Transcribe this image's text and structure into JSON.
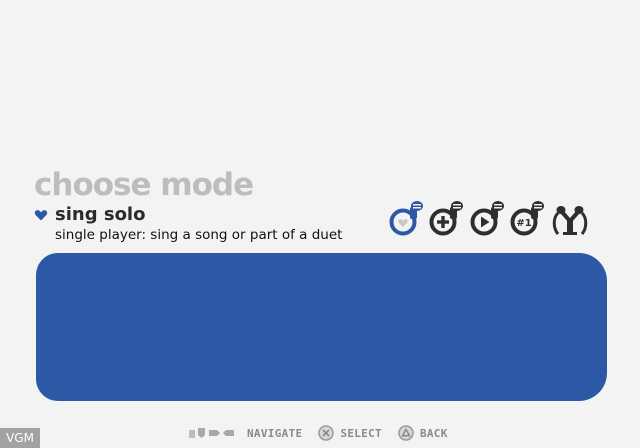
{
  "screen": {
    "title": "choose mode"
  },
  "selected_mode": {
    "name": "sing solo",
    "description": "single player: sing a song or part of a duet",
    "marker_icon": "heart-icon"
  },
  "mode_icons": [
    {
      "name": "sing-solo",
      "icon": "heart-mic-icon",
      "selected": true
    },
    {
      "name": "add-player",
      "icon": "plus-mic-icon",
      "selected": false
    },
    {
      "name": "play",
      "icon": "play-mic-icon",
      "selected": false
    },
    {
      "name": "ranking",
      "icon": "number-one-mic-icon",
      "selected": false,
      "glyph": "#1"
    },
    {
      "name": "duet",
      "icon": "two-mics-icon",
      "selected": false
    }
  ],
  "controls": {
    "navigate_label": "NAVIGATE",
    "select_label": "SELECT",
    "back_label": "BACK"
  },
  "watermark": "VGM",
  "colors": {
    "accent": "#2d58a6",
    "background": "#f3f3f3",
    "title": "#bdbdbd",
    "icon_dark": "#2e2e2e"
  }
}
